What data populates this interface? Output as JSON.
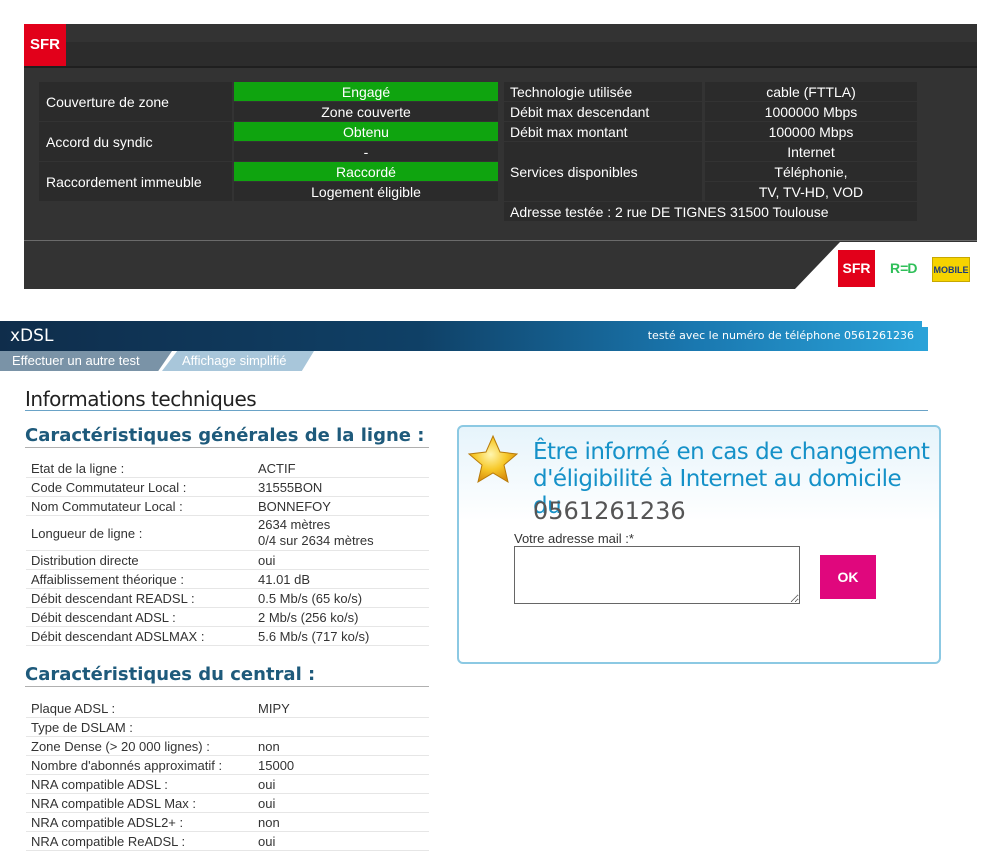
{
  "sfr": {
    "logo_text": "SFR",
    "rows": [
      {
        "label": "Couverture de zone",
        "status": "Engagé",
        "status_green": true,
        "sub": "Zone couverte"
      },
      {
        "label": "Accord du syndic",
        "status": "Obtenu",
        "status_green": true,
        "sub": "-"
      },
      {
        "label": "Raccordement immeuble",
        "status": "Raccordé",
        "status_green": true,
        "sub": "Logement éligible"
      }
    ],
    "tech": [
      {
        "label": "Technologie utilisée",
        "value": "cable (FTTLA)"
      },
      {
        "label": "Débit max descendant",
        "value": "1000000 Mbps"
      },
      {
        "label": "Débit max montant",
        "value": "100000 Mbps"
      }
    ],
    "services_label": "Services disponibles",
    "services": [
      "Internet",
      "Téléphonie,",
      "TV, TV-HD, VOD"
    ],
    "address": "Adresse testée : 2 rue DE TIGNES 31500 Toulouse",
    "footer_logos": {
      "sfr": "SFR",
      "red": "RED",
      "laposte_top": "LA POSTE",
      "laposte_bottom": "MOBILE"
    },
    "colors": {
      "green": "#0fa40f",
      "red": "#e2001a",
      "panel": "#333333"
    }
  },
  "xdsl": {
    "title": "xDSL",
    "tested_with": "testé avec le numéro de téléphone 0561261236",
    "tabs": [
      "Effectuer un autre test",
      "Affichage simplifié"
    ],
    "info_title": "Informations techniques",
    "general": {
      "title": "Caractéristiques générales de la ligne :",
      "rows": [
        {
          "k": "Etat de la ligne :",
          "v": "ACTIF"
        },
        {
          "k": "Code Commutateur Local :",
          "v": "31555BON"
        },
        {
          "k": "Nom Commutateur Local :",
          "v": "BONNEFOY"
        },
        {
          "k": "Longueur de ligne :",
          "v": "2634 mètres",
          "v2": "0/4 sur 2634 mètres"
        },
        {
          "k": "Distribution directe",
          "v": "oui"
        },
        {
          "k": "Affaiblissement théorique :",
          "v": "41.01 dB"
        },
        {
          "k": "Débit descendant READSL :",
          "v": "0.5 Mb/s (65 ko/s)"
        },
        {
          "k": "Débit descendant ADSL :",
          "v": "2 Mb/s (256 ko/s)"
        },
        {
          "k": "Débit descendant ADSLMAX :",
          "v": "5.6 Mb/s (717 ko/s)"
        }
      ]
    },
    "central": {
      "title": "Caractéristiques du central :",
      "rows": [
        {
          "k": "Plaque ADSL :",
          "v": "MIPY"
        },
        {
          "k": "Type de DSLAM :",
          "v": ""
        },
        {
          "k": "Zone Dense (> 20 000 lignes) :",
          "v": "non"
        },
        {
          "k": "Nombre d'abonnés approximatif :",
          "v": "15000"
        },
        {
          "k": "NRA compatible ADSL :",
          "v": "oui"
        },
        {
          "k": "NRA compatible ADSL Max :",
          "v": "oui"
        },
        {
          "k": "NRA compatible ADSL2+ :",
          "v": "non"
        },
        {
          "k": "NRA compatible ReADSL :",
          "v": "oui"
        }
      ]
    },
    "notify": {
      "title": "Être informé en cas de changement d'éligibilité à Internet au domicile du",
      "phone": "0561261236",
      "email_label": "Votre adresse mail :*",
      "email_value": "",
      "ok_label": "OK"
    },
    "colors": {
      "accent_blue": "#1591c8",
      "section_title": "#1e5a7b",
      "ok_pink": "#e0077d"
    }
  }
}
